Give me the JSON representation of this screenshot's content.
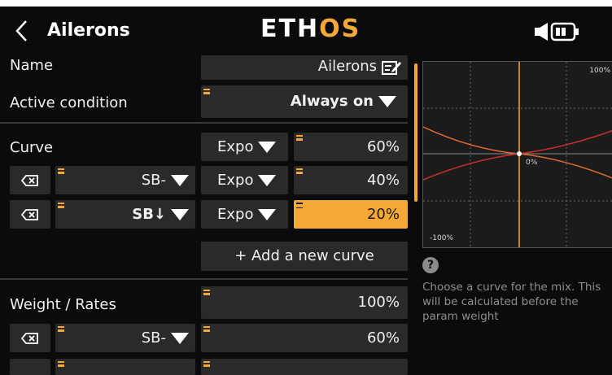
{
  "header": {
    "title": "Ailerons",
    "brand_main": "ETH",
    "brand_accent": "OS"
  },
  "rows": {
    "name": {
      "label": "Name",
      "value": "Ailerons"
    },
    "active_condition": {
      "label": "Active condition",
      "value": "Always on"
    },
    "curve": {
      "label": "Curve",
      "type": "Expo",
      "value": "60%"
    },
    "curve_alt1": {
      "switch": "SB-",
      "type": "Expo",
      "value": "40%"
    },
    "curve_alt2": {
      "switch": "SB↓",
      "type": "Expo",
      "value": "20%"
    },
    "add_curve": "+ Add a new curve",
    "weight": {
      "label": "Weight / Rates",
      "value": "100%"
    },
    "weight_alt1": {
      "switch": "SB-",
      "value": "60%"
    }
  },
  "graph": {
    "top_right": "100%",
    "center": "0%",
    "bottom_left": "-100%"
  },
  "help": {
    "text": "Choose a curve for the mix. This will be calculated before the param weight"
  },
  "colors": {
    "accent": "#f5a836",
    "field_bg": "#2a2a2a",
    "background": "#0b0b0b"
  }
}
